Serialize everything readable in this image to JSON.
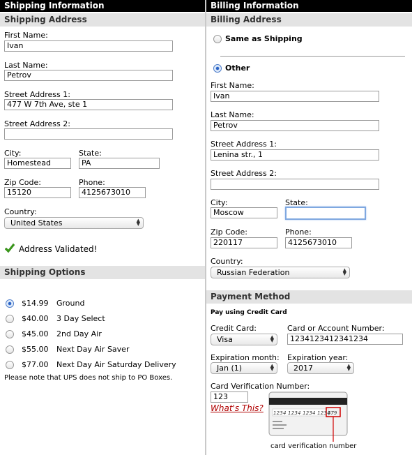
{
  "shipping": {
    "header": "Shipping Information",
    "section_address": "Shipping Address",
    "first_name_label": "First Name:",
    "first_name": "Ivan",
    "last_name_label": "Last Name:",
    "last_name": "Petrov",
    "street1_label": "Street Address 1:",
    "street1": "477 W 7th Ave, ste 1",
    "street2_label": "Street Address 2:",
    "street2": "",
    "city_label": "City:",
    "city": "Homestead",
    "state_label": "State:",
    "state": "PA",
    "zip_label": "Zip Code:",
    "zip": "15120",
    "phone_label": "Phone:",
    "phone": "4125673010",
    "country_label": "Country:",
    "country": "United States",
    "validated_text": "Address Validated!",
    "section_options": "Shipping Options",
    "options": [
      {
        "price": "$14.99",
        "name": "Ground",
        "selected": true
      },
      {
        "price": "$40.00",
        "name": "3 Day Select",
        "selected": false
      },
      {
        "price": "$45.00",
        "name": "2nd Day Air",
        "selected": false
      },
      {
        "price": "$55.00",
        "name": "Next Day Air Saver",
        "selected": false
      },
      {
        "price": "$77.00",
        "name": "Next Day Air Saturday Delivery",
        "selected": false
      }
    ],
    "note": "Please note that UPS does not ship to PO Boxes."
  },
  "billing": {
    "header": "Billing Information",
    "section_address": "Billing Address",
    "same_as_shipping": "Same as Shipping",
    "other": "Other",
    "first_name_label": "First Name:",
    "first_name": "Ivan",
    "last_name_label": "Last Name:",
    "last_name": "Petrov",
    "street1_label": "Street Address 1:",
    "street1": "Lenina str., 1",
    "street2_label": "Street Address 2:",
    "street2": "",
    "city_label": "City:",
    "city": "Moscow",
    "state_label": "State:",
    "state": "",
    "zip_label": "Zip Code:",
    "zip": "220117",
    "phone_label": "Phone:",
    "phone": "4125673010",
    "country_label": "Country:",
    "country": "Russian Federation"
  },
  "payment": {
    "section": "Payment Method",
    "pay_using": "Pay using Credit Card",
    "card_label": "Credit Card:",
    "card": "Visa",
    "number_label": "Card or Account Number:",
    "number": "1234123412341234",
    "exp_month_label": "Expiration month:",
    "exp_month": "Jan (1)",
    "exp_year_label": "Expiration year:",
    "exp_year": "2017",
    "cvv_label": "Card Verification Number:",
    "cvv": "123",
    "whats_this": "What's This?",
    "card_image_digits": "1234 1234 1234 1234",
    "card_image_cvv": "579",
    "card_image_caption": "card verification number"
  },
  "colors": {
    "accent_link": "#b00000",
    "check": "#3a9a1a",
    "header_bg": "#000000",
    "section_bg": "#e3e3e3"
  }
}
